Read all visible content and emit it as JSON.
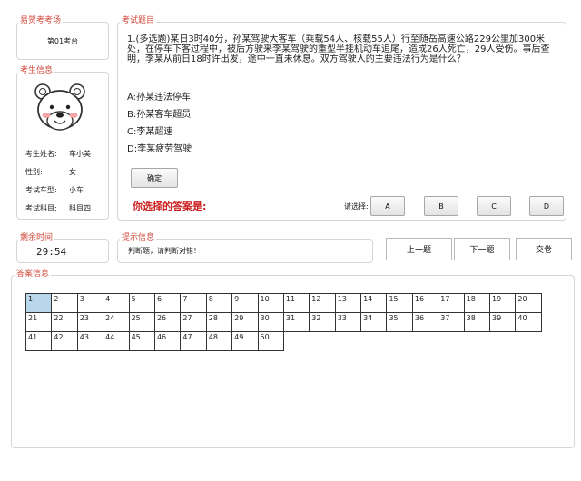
{
  "exam_room": {
    "legend": "易贺考考场",
    "seat": "第01考台"
  },
  "candidate": {
    "legend": "考生信息",
    "rows": [
      {
        "label": "考生姓名:",
        "value": "车小美"
      },
      {
        "label": "性别:",
        "value": "女"
      },
      {
        "label": "考试车型:",
        "value": "小车"
      },
      {
        "label": "考试科目:",
        "value": "科目四"
      }
    ]
  },
  "question": {
    "legend": "考试题目",
    "text": "1.(多选题)某日3时40分，孙某驾驶大客车（乘载54人、核载55人）行至随岳高速公路229公里加300米处，在停车下客过程中，被后方驶来李某驾驶的重型半挂机动车追尾，造成26人死亡，29人受伤。事后查明，李某从前日18时许出发，途中一直未休息。双方驾驶人的主要违法行为是什么？",
    "options": [
      "A:孙某违法停车",
      "B:孙某客车超员",
      "C:李某超速",
      "D:李某疲劳驾驶"
    ],
    "confirm_label": "确定",
    "your_answer_label": "你选择的答案是:",
    "select_label": "请选择:",
    "choices": [
      "A",
      "B",
      "C",
      "D"
    ]
  },
  "timer": {
    "legend": "剩余时间",
    "value": "29:54"
  },
  "hint": {
    "legend": "提示信息",
    "text": "判断题，请判断对错！"
  },
  "nav": {
    "prev": "上一题",
    "next": "下一题",
    "submit": "交卷"
  },
  "answers": {
    "legend": "答案信息",
    "rows": [
      [
        "1",
        "2",
        "3",
        "4",
        "5",
        "6",
        "7",
        "8",
        "9",
        "10",
        "11",
        "12",
        "13",
        "14",
        "15",
        "16",
        "17",
        "18",
        "19",
        "20"
      ],
      [
        "21",
        "22",
        "23",
        "24",
        "25",
        "26",
        "27",
        "28",
        "29",
        "30",
        "31",
        "32",
        "33",
        "34",
        "35",
        "36",
        "37",
        "38",
        "39",
        "40"
      ],
      [
        "41",
        "42",
        "43",
        "44",
        "45",
        "46",
        "47",
        "48",
        "49",
        "50"
      ]
    ],
    "current": "1"
  },
  "colors": {
    "legend": "#d24a3c",
    "answer_prompt": "#cc1f1f",
    "current_cell": "#b9d7ea"
  }
}
